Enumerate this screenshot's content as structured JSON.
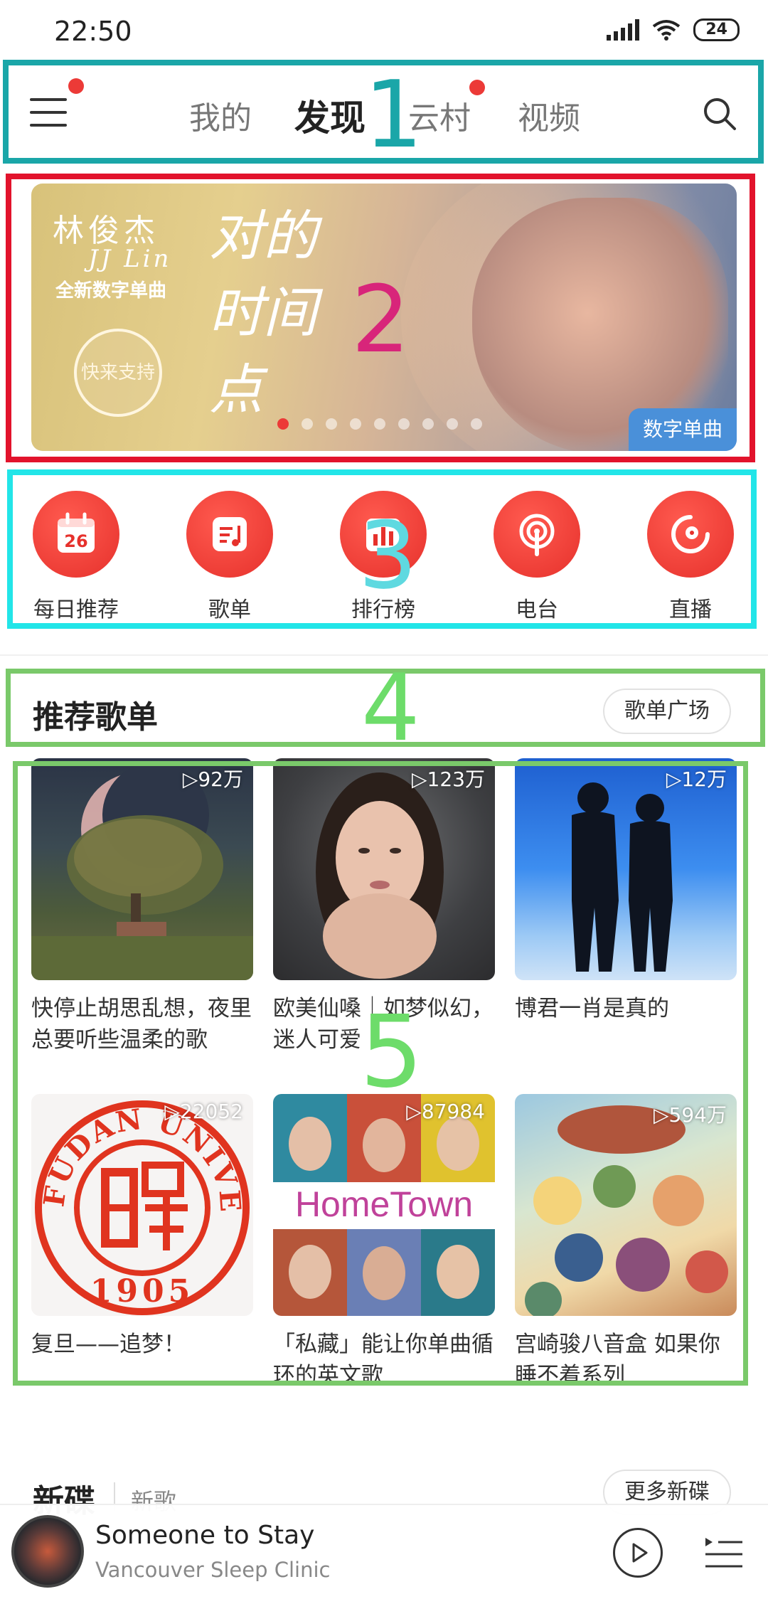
{
  "status_bar": {
    "time": "22:50",
    "battery": "24"
  },
  "nav": {
    "tabs": [
      "我的",
      "发现",
      "云村",
      "视频"
    ],
    "active_index": 1
  },
  "banner": {
    "singer_cn": "林俊杰",
    "singer_en": "JJ Lin",
    "subtitle": "全新数字单曲",
    "song_title": "对的时间点",
    "button_label": "快来支持",
    "tag": "数字单曲",
    "page_count": 9,
    "active_page": 1
  },
  "shortcuts": [
    {
      "label": "每日推荐",
      "icon": "calendar-icon",
      "icon_text": "26"
    },
    {
      "label": "歌单",
      "icon": "playlist-icon"
    },
    {
      "label": "排行榜",
      "icon": "chart-icon"
    },
    {
      "label": "电台",
      "icon": "radio-icon"
    },
    {
      "label": "直播",
      "icon": "live-icon"
    }
  ],
  "recommend": {
    "title": "推荐歌单",
    "more_label": "歌单广场",
    "playlists": [
      {
        "plays": "▷92万",
        "title": "快停止胡思乱想，夜里总要听些温柔的歌"
      },
      {
        "plays": "▷123万",
        "title": "欧美仙嗓｜如梦似幻，迷人可爱"
      },
      {
        "plays": "▷12万",
        "title": "博君一肖是真的"
      },
      {
        "plays": "▷22052",
        "title": "复旦——追梦！"
      },
      {
        "plays": "▷87984",
        "title": "「私藏」能让你单曲循环的英文歌"
      },
      {
        "plays": "▷594万",
        "title": "宫崎骏八音盒 如果你睡不着系列"
      }
    ],
    "cover_texts": {
      "hometown": "HomeTown",
      "fudan_arc": "FUDAN UNIVERSITY",
      "fudan_year": "1905"
    }
  },
  "new_albums": {
    "title": "新碟",
    "sub": "新歌",
    "more_label": "更多新碟"
  },
  "player": {
    "title": "Someone to Stay",
    "artist": "Vancouver Sleep Clinic"
  },
  "annotations": [
    "1",
    "2",
    "3",
    "4",
    "5"
  ],
  "colors": {
    "brand_red": "#ec3a37",
    "box1": "#1aa6a8",
    "box2": "#e2132c",
    "box3": "#22e5e8",
    "box4": "#7ac96a",
    "num2": "#d8257a",
    "num3": "#5fd9e0",
    "num4": "#6ddc6a"
  }
}
